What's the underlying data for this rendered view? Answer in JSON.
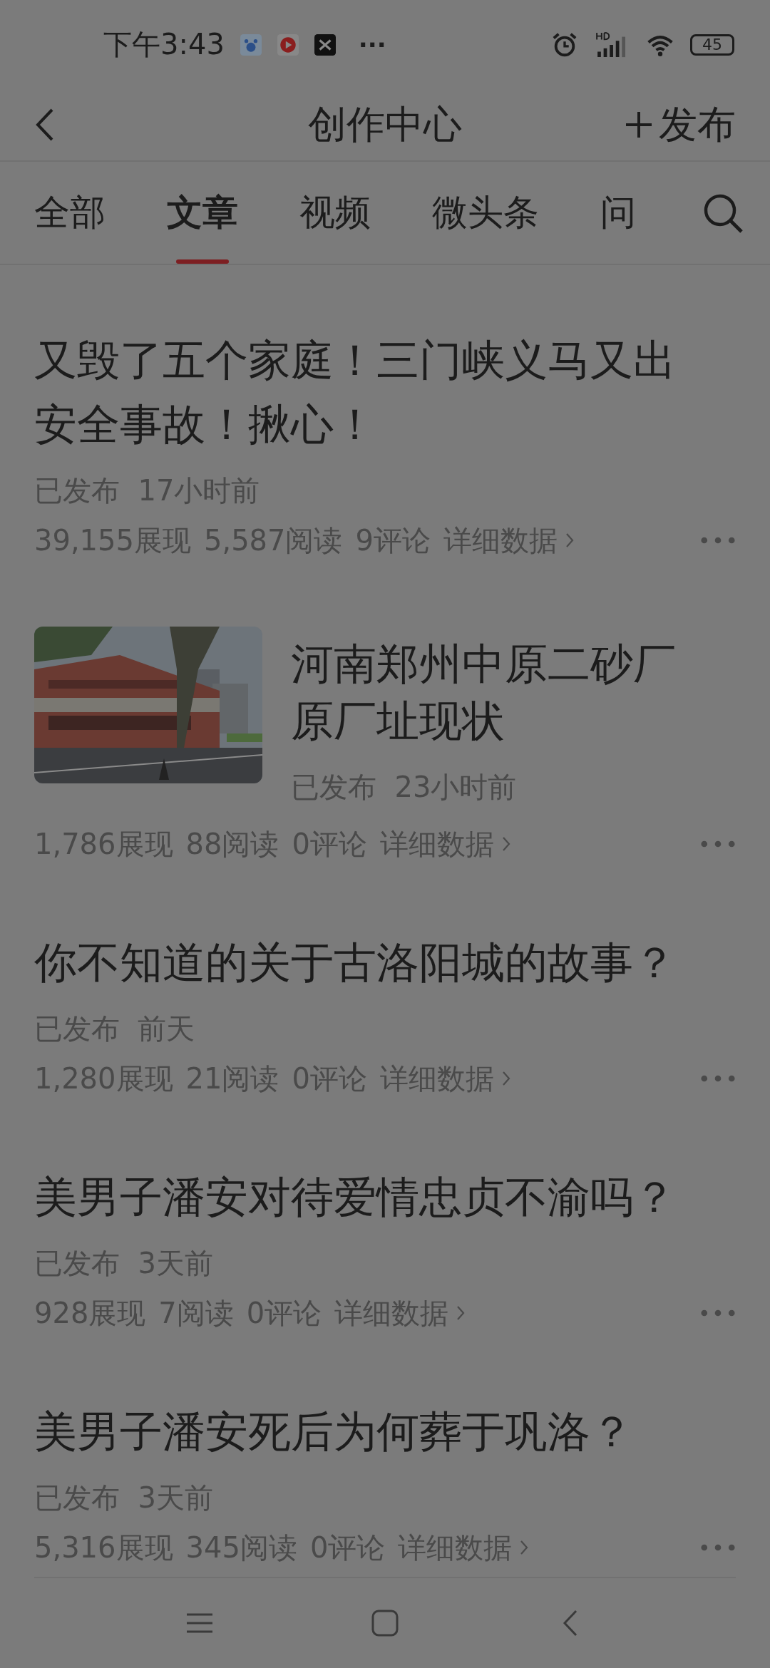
{
  "status_bar": {
    "time": "下午3:43",
    "more": "···",
    "battery": "45"
  },
  "header": {
    "title": "创作中心",
    "publish": "发布"
  },
  "tabs": [
    {
      "label": "全部",
      "selected": false
    },
    {
      "label": "文章",
      "selected": true
    },
    {
      "label": "视频",
      "selected": false
    },
    {
      "label": "微头条",
      "selected": false
    },
    {
      "label": "问",
      "selected": false
    }
  ],
  "articles": [
    {
      "kind": "text",
      "title": "又毁了五个家庭！三门峡义马又出安全事故！揪心！",
      "status": "已发布",
      "time": "17小时前",
      "impressions": "39,155展现",
      "reads": "5,587阅读",
      "comments": "9评论",
      "details": "详细数据"
    },
    {
      "kind": "picture",
      "title": "河南郑州中原二砂厂原厂址现状",
      "status": "已发布",
      "time": "23小时前",
      "impressions": "1,786展现",
      "reads": "88阅读",
      "comments": "0评论",
      "details": "详细数据"
    },
    {
      "kind": "text",
      "title": "你不知道的关于古洛阳城的故事？",
      "status": "已发布",
      "time": "前天",
      "impressions": "1,280展现",
      "reads": "21阅读",
      "comments": "0评论",
      "details": "详细数据"
    },
    {
      "kind": "text",
      "title": "美男子潘安对待爱情忠贞不渝吗？",
      "status": "已发布",
      "time": "3天前",
      "impressions": "928展现",
      "reads": "7阅读",
      "comments": "0评论",
      "details": "详细数据"
    },
    {
      "kind": "text",
      "title": "美男子潘安死后为何葬于巩洛？",
      "status": "已发布",
      "time": "3天前",
      "impressions": "5,316展现",
      "reads": "345阅读",
      "comments": "0评论",
      "details": "详细数据"
    }
  ]
}
